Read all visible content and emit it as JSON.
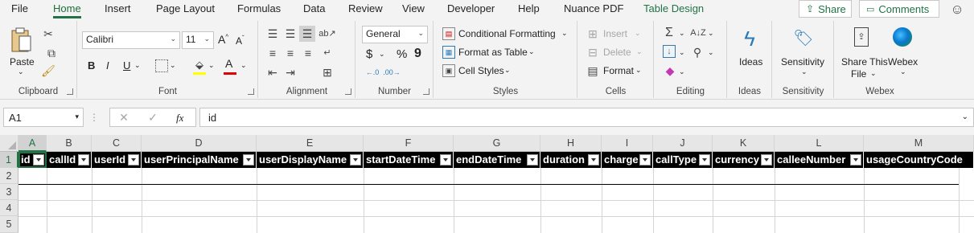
{
  "tabs": [
    "File",
    "Home",
    "Insert",
    "Page Layout",
    "Formulas",
    "Data",
    "Review",
    "View",
    "Developer",
    "Help",
    "Nuance PDF",
    "Table Design"
  ],
  "top_buttons": {
    "share": "Share",
    "comments": "Comments"
  },
  "ribbon": {
    "clipboard": {
      "paste": "Paste",
      "label": "Clipboard"
    },
    "font": {
      "name": "Calibri",
      "size": "11",
      "bold": "B",
      "italic": "I",
      "underline": "U",
      "label": "Font"
    },
    "alignment": {
      "label": "Alignment"
    },
    "number": {
      "format": "General",
      "currency": "$",
      "percent": "%",
      "comma": "9",
      "label": "Number"
    },
    "styles": {
      "conditional": "Conditional Formatting",
      "format_table": "Format as Table",
      "cell_styles": "Cell Styles",
      "label": "Styles"
    },
    "cells": {
      "insert": "Insert",
      "delete": "Delete",
      "format": "Format",
      "label": "Cells"
    },
    "editing": {
      "label": "Editing"
    },
    "ideas": {
      "btn": "Ideas",
      "label": "Ideas"
    },
    "sensitivity": {
      "btn": "Sensitivity",
      "label": "Sensitivity"
    },
    "webex": {
      "share1": "Share This",
      "share2": "File",
      "webex": "Webex",
      "label": "Webex"
    }
  },
  "formula_bar": {
    "name_box": "A1",
    "fx": "fx",
    "content": "id"
  },
  "columns": [
    "A",
    "B",
    "C",
    "D",
    "E",
    "F",
    "G",
    "H",
    "I",
    "J",
    "K",
    "L",
    "M"
  ],
  "rows": [
    "1",
    "2",
    "3",
    "4",
    "5"
  ],
  "headers": [
    "id",
    "callId",
    "userId",
    "userPrincipalName",
    "userDisplayName",
    "startDateTime",
    "endDateTime",
    "duration",
    "charge",
    "callType",
    "currency",
    "calleeNumber",
    "usageCountryCode"
  ],
  "colors": {
    "accent": "#217346",
    "header_bg": "#000000",
    "header_text": "#ffffff"
  }
}
